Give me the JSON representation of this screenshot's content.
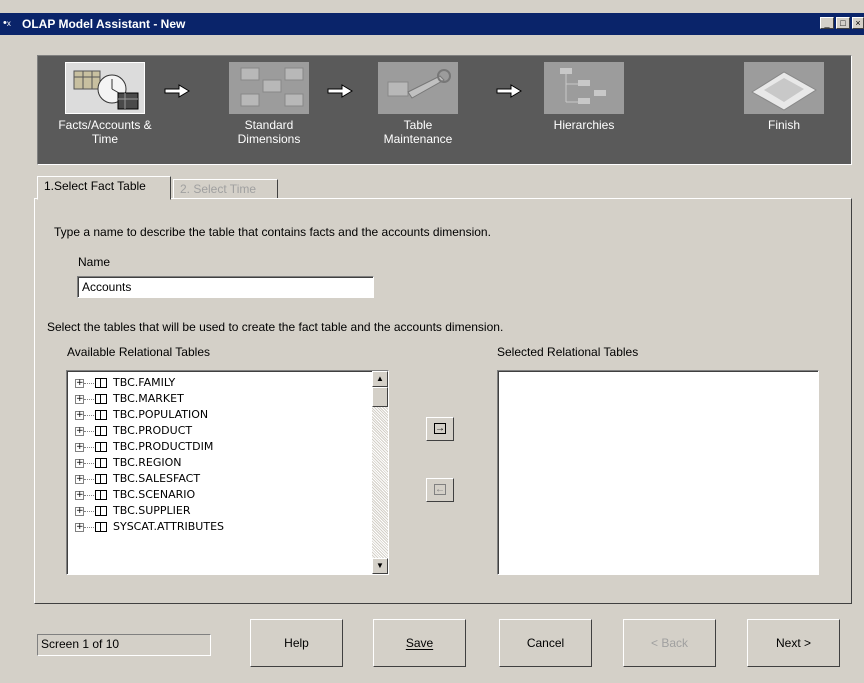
{
  "window": {
    "title": "OLAP Model Assistant - New",
    "controls": {
      "minimize": "_",
      "maximize": "□",
      "close": "×"
    }
  },
  "steps": [
    {
      "label": "Facts/Accounts &\nTime",
      "icon": "calendar-clock-icon",
      "active": true
    },
    {
      "label": "Standard\nDimensions",
      "icon": "tables-icon",
      "active": false
    },
    {
      "label": "Table\nMaintenance",
      "icon": "wrench-icon",
      "active": false
    },
    {
      "label": "Hierarchies",
      "icon": "hierarchy-icon",
      "active": false
    },
    {
      "label": "Finish",
      "icon": "finish-flag-icon",
      "active": false
    }
  ],
  "tabs": [
    {
      "label": "1.Select Fact Table",
      "state": "active"
    },
    {
      "label": "2. Select Time",
      "state": "disabled"
    }
  ],
  "form": {
    "instruction": "Type a name to describe the table that contains facts and the accounts dimension.",
    "name_label": "Name",
    "name_value": "Accounts",
    "select_instruction": "Select the tables that will be used to create the fact table and the accounts dimension.",
    "available_label": "Available Relational Tables",
    "selected_label": "Selected Relational Tables",
    "available_tables": [
      "TBC.FAMILY",
      "TBC.MARKET",
      "TBC.POPULATION",
      "TBC.PRODUCT",
      "TBC.PRODUCTDIM",
      "TBC.REGION",
      "TBC.SALESFACT",
      "TBC.SCENARIO",
      "TBC.SUPPLIER",
      "SYSCAT.ATTRIBUTES"
    ],
    "selected_tables": []
  },
  "footer": {
    "status": "Screen 1 of 10",
    "buttons": {
      "help": "Help",
      "save": "Save",
      "cancel": "Cancel",
      "back": "< Back",
      "next": "Next >"
    }
  },
  "colors": {
    "title_bar": "#0a246a",
    "wizard_bar": "#5a5a5a",
    "window_face": "#d4d0c8"
  }
}
